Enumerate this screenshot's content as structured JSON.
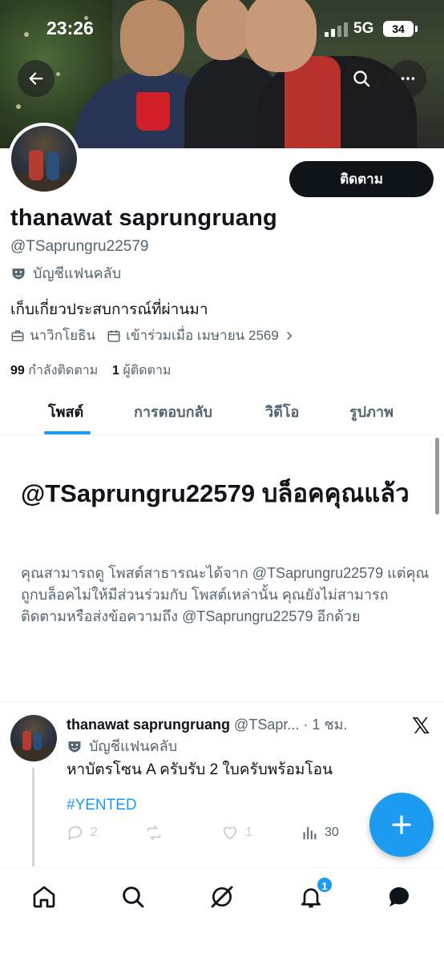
{
  "status_bar": {
    "time": "23:26",
    "network": "5G",
    "battery": "34"
  },
  "profile": {
    "follow_label": "ติดตาม",
    "name": "thanawat saprungruang",
    "handle": "@TSaprungru22579",
    "account_type": "บัญชีแฟนคลับ",
    "bio": "เก็บเกี่ยวประสบการณ์ที่ผ่านมา",
    "occupation": "นาวิกโยธิน",
    "joined": "เข้าร่วมเมื่อ เมษายน 2569",
    "following_count": "99",
    "following_label": "กำลังติดตาม",
    "followers_count": "1",
    "followers_label": "ผู้ติดตาม"
  },
  "tabs": [
    {
      "label": "โพสต์",
      "active": true
    },
    {
      "label": "การตอบกลับ",
      "active": false
    },
    {
      "label": "วิดีโอ",
      "active": false
    },
    {
      "label": "รูปภาพ",
      "active": false
    }
  ],
  "blocked": {
    "title": "@TSaprungru22579 บล็อคคุณแล้ว",
    "description": "คุณสามารถดู โพสต์สาธารณะได้จาก @TSaprungru22579 แต่คุณถูกบล็อคไม่ให้มีส่วนร่วมกับ โพสต์เหล่านั้น คุณยังไม่สามารถติดตามหรือส่งข้อความถึง @TSaprungru22579 อีกด้วย"
  },
  "post": {
    "name": "thanawat saprungruang",
    "handle_time": "@TSapr... · 1 ชม.",
    "account_type": "บัญชีแฟนคลับ",
    "text": "หาบัตรโซน A ครับรับ 2 ใบครับพร้อมโอน",
    "hashtag": "#YENTED",
    "replies": "2",
    "reposts": "",
    "likes": "1",
    "views": "30"
  },
  "nav": {
    "notification_count": "1",
    "icons": [
      "home-icon",
      "search-icon",
      "grok-icon",
      "bell-icon",
      "chat-icon"
    ]
  },
  "colors": {
    "accent": "#1d9bf0",
    "text": "#0f1419",
    "muted": "#536471"
  }
}
